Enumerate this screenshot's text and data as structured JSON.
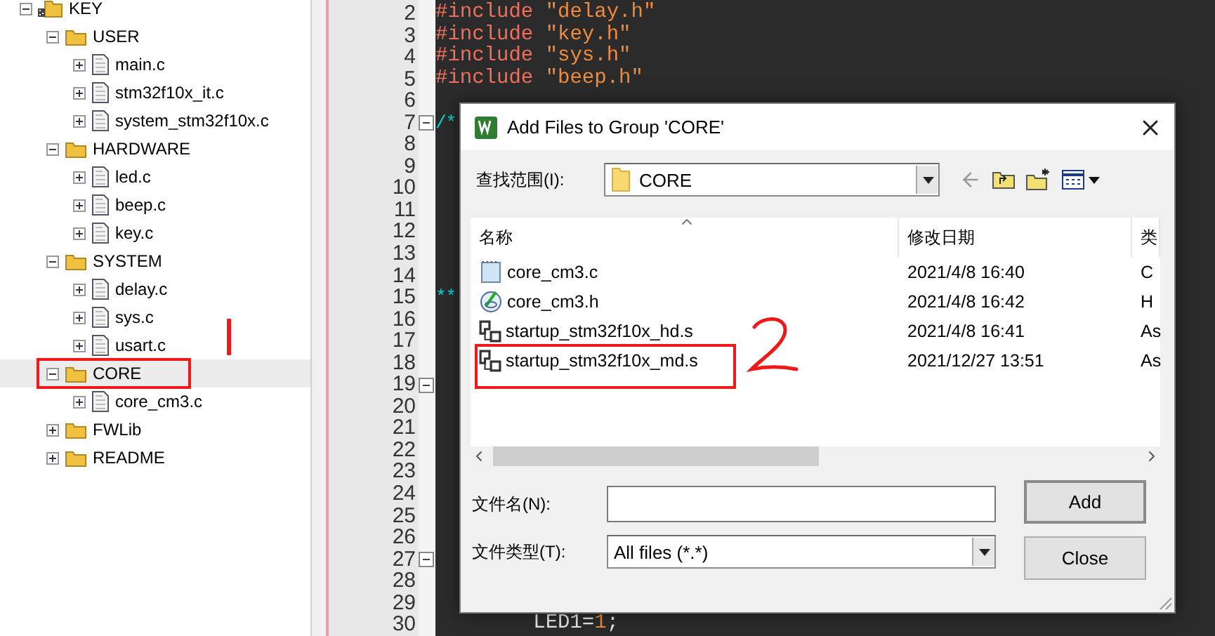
{
  "project_tree": {
    "items": [
      {
        "label": "KEY",
        "kind": "root",
        "expanded": true,
        "selected": false,
        "children": [
          {
            "label": "USER",
            "kind": "group",
            "expanded": true,
            "selected": false,
            "children": [
              {
                "label": "main.c",
                "kind": "file",
                "expanded": false,
                "selected": false
              },
              {
                "label": "stm32f10x_it.c",
                "kind": "file",
                "expanded": false,
                "selected": false
              },
              {
                "label": "system_stm32f10x.c",
                "kind": "file",
                "expanded": false,
                "selected": false
              }
            ]
          },
          {
            "label": "HARDWARE",
            "kind": "group",
            "expanded": true,
            "selected": false,
            "children": [
              {
                "label": "led.c",
                "kind": "file",
                "expanded": false,
                "selected": false
              },
              {
                "label": "beep.c",
                "kind": "file",
                "expanded": false,
                "selected": false
              },
              {
                "label": "key.c",
                "kind": "file",
                "expanded": false,
                "selected": false
              }
            ]
          },
          {
            "label": "SYSTEM",
            "kind": "group",
            "expanded": true,
            "selected": false,
            "children": [
              {
                "label": "delay.c",
                "kind": "file",
                "expanded": false,
                "selected": false
              },
              {
                "label": "sys.c",
                "kind": "file",
                "expanded": false,
                "selected": false
              },
              {
                "label": "usart.c",
                "kind": "file",
                "expanded": false,
                "selected": false
              }
            ]
          },
          {
            "label": "CORE",
            "kind": "group",
            "expanded": true,
            "selected": true,
            "highlighted": true,
            "children": [
              {
                "label": "core_cm3.c",
                "kind": "file",
                "expanded": false,
                "selected": false
              }
            ]
          },
          {
            "label": "FWLib",
            "kind": "group",
            "expanded": false,
            "selected": false
          },
          {
            "label": "README",
            "kind": "group",
            "expanded": false,
            "selected": false
          }
        ]
      }
    ]
  },
  "editor": {
    "lines": [
      {
        "number": "2",
        "segments": [
          {
            "text": "#include ",
            "kind": "directive"
          },
          {
            "text": "\"delay.h\"",
            "kind": "string"
          }
        ]
      },
      {
        "number": "3",
        "segments": [
          {
            "text": "#include ",
            "kind": "directive"
          },
          {
            "text": "\"key.h\"",
            "kind": "string"
          }
        ]
      },
      {
        "number": "4",
        "segments": [
          {
            "text": "#include ",
            "kind": "directive"
          },
          {
            "text": "\"sys.h\"",
            "kind": "string"
          }
        ]
      },
      {
        "number": "5",
        "segments": [
          {
            "text": "#include ",
            "kind": "directive"
          },
          {
            "text": "\"beep.h\"",
            "kind": "string"
          }
        ]
      },
      {
        "number": "6"
      },
      {
        "number": "7",
        "fold_toggle": true,
        "segments": [
          {
            "text": "/*",
            "kind": "comment"
          }
        ]
      },
      {
        "number": "8"
      },
      {
        "number": "9"
      },
      {
        "number": "10"
      },
      {
        "number": "11"
      },
      {
        "number": "12"
      },
      {
        "number": "13"
      },
      {
        "number": "14"
      },
      {
        "number": "15",
        "segments": [
          {
            "text": "**",
            "kind": "comment"
          }
        ]
      },
      {
        "number": "16"
      },
      {
        "number": "17"
      },
      {
        "number": "18"
      },
      {
        "number": "19",
        "fold_toggle": true
      },
      {
        "number": "20"
      },
      {
        "number": "21"
      },
      {
        "number": "22"
      },
      {
        "number": "23"
      },
      {
        "number": "24"
      },
      {
        "number": "25"
      },
      {
        "number": "26"
      },
      {
        "number": "27",
        "fold_toggle": true
      },
      {
        "number": "28"
      },
      {
        "number": "29"
      },
      {
        "number": "30",
        "segments": [
          {
            "text": "        LED1=",
            "kind": "plain"
          },
          {
            "text": "1",
            "kind": "number"
          },
          {
            "text": ";",
            "kind": "plain"
          }
        ]
      }
    ]
  },
  "dialog": {
    "title": "Add Files to Group 'CORE'",
    "look_in": {
      "label": "查找范围(I):",
      "value": "CORE"
    },
    "columns": [
      "名称",
      "修改日期",
      "类"
    ],
    "files": [
      {
        "name": "core_cm3.c",
        "kind": "c",
        "date": "2021/4/8 16:40",
        "type": "C"
      },
      {
        "name": "core_cm3.h",
        "kind": "h",
        "date": "2021/4/8 16:42",
        "type": "H"
      },
      {
        "name": "startup_stm32f10x_hd.s",
        "kind": "asm",
        "date": "2021/4/8 16:41",
        "type": "As"
      },
      {
        "name": "startup_stm32f10x_md.s",
        "kind": "asm",
        "date": "2021/12/27 13:51",
        "type": "As",
        "highlighted": true
      }
    ],
    "file_name": {
      "label": "文件名(N):"
    },
    "file_type": {
      "label": "文件类型(T):",
      "value": "All files (*.*)"
    },
    "buttons": [
      "Add",
      "Close"
    ]
  }
}
